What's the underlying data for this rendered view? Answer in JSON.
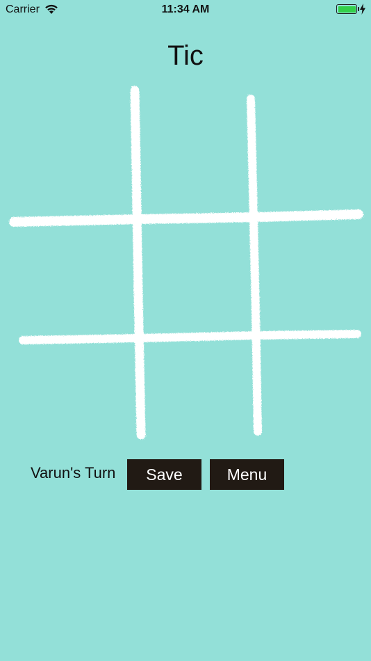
{
  "status_bar": {
    "carrier": "Carrier",
    "time": "11:34 AM",
    "battery_color": "#33d04a"
  },
  "app": {
    "title": "Tic",
    "background_color": "#93e0d8"
  },
  "board": {
    "style": "chalk-grid",
    "line_color": "#ffffff",
    "cells": [
      "",
      "",
      "",
      "",
      "",
      "",
      "",
      "",
      ""
    ]
  },
  "controls": {
    "turn_text": "Varun's Turn",
    "save_label": "Save",
    "menu_label": "Menu",
    "button_color": "#211a14"
  },
  "icons": {
    "wifi": "wifi-icon",
    "battery": "battery-icon",
    "charging": "charging-bolt-icon"
  }
}
